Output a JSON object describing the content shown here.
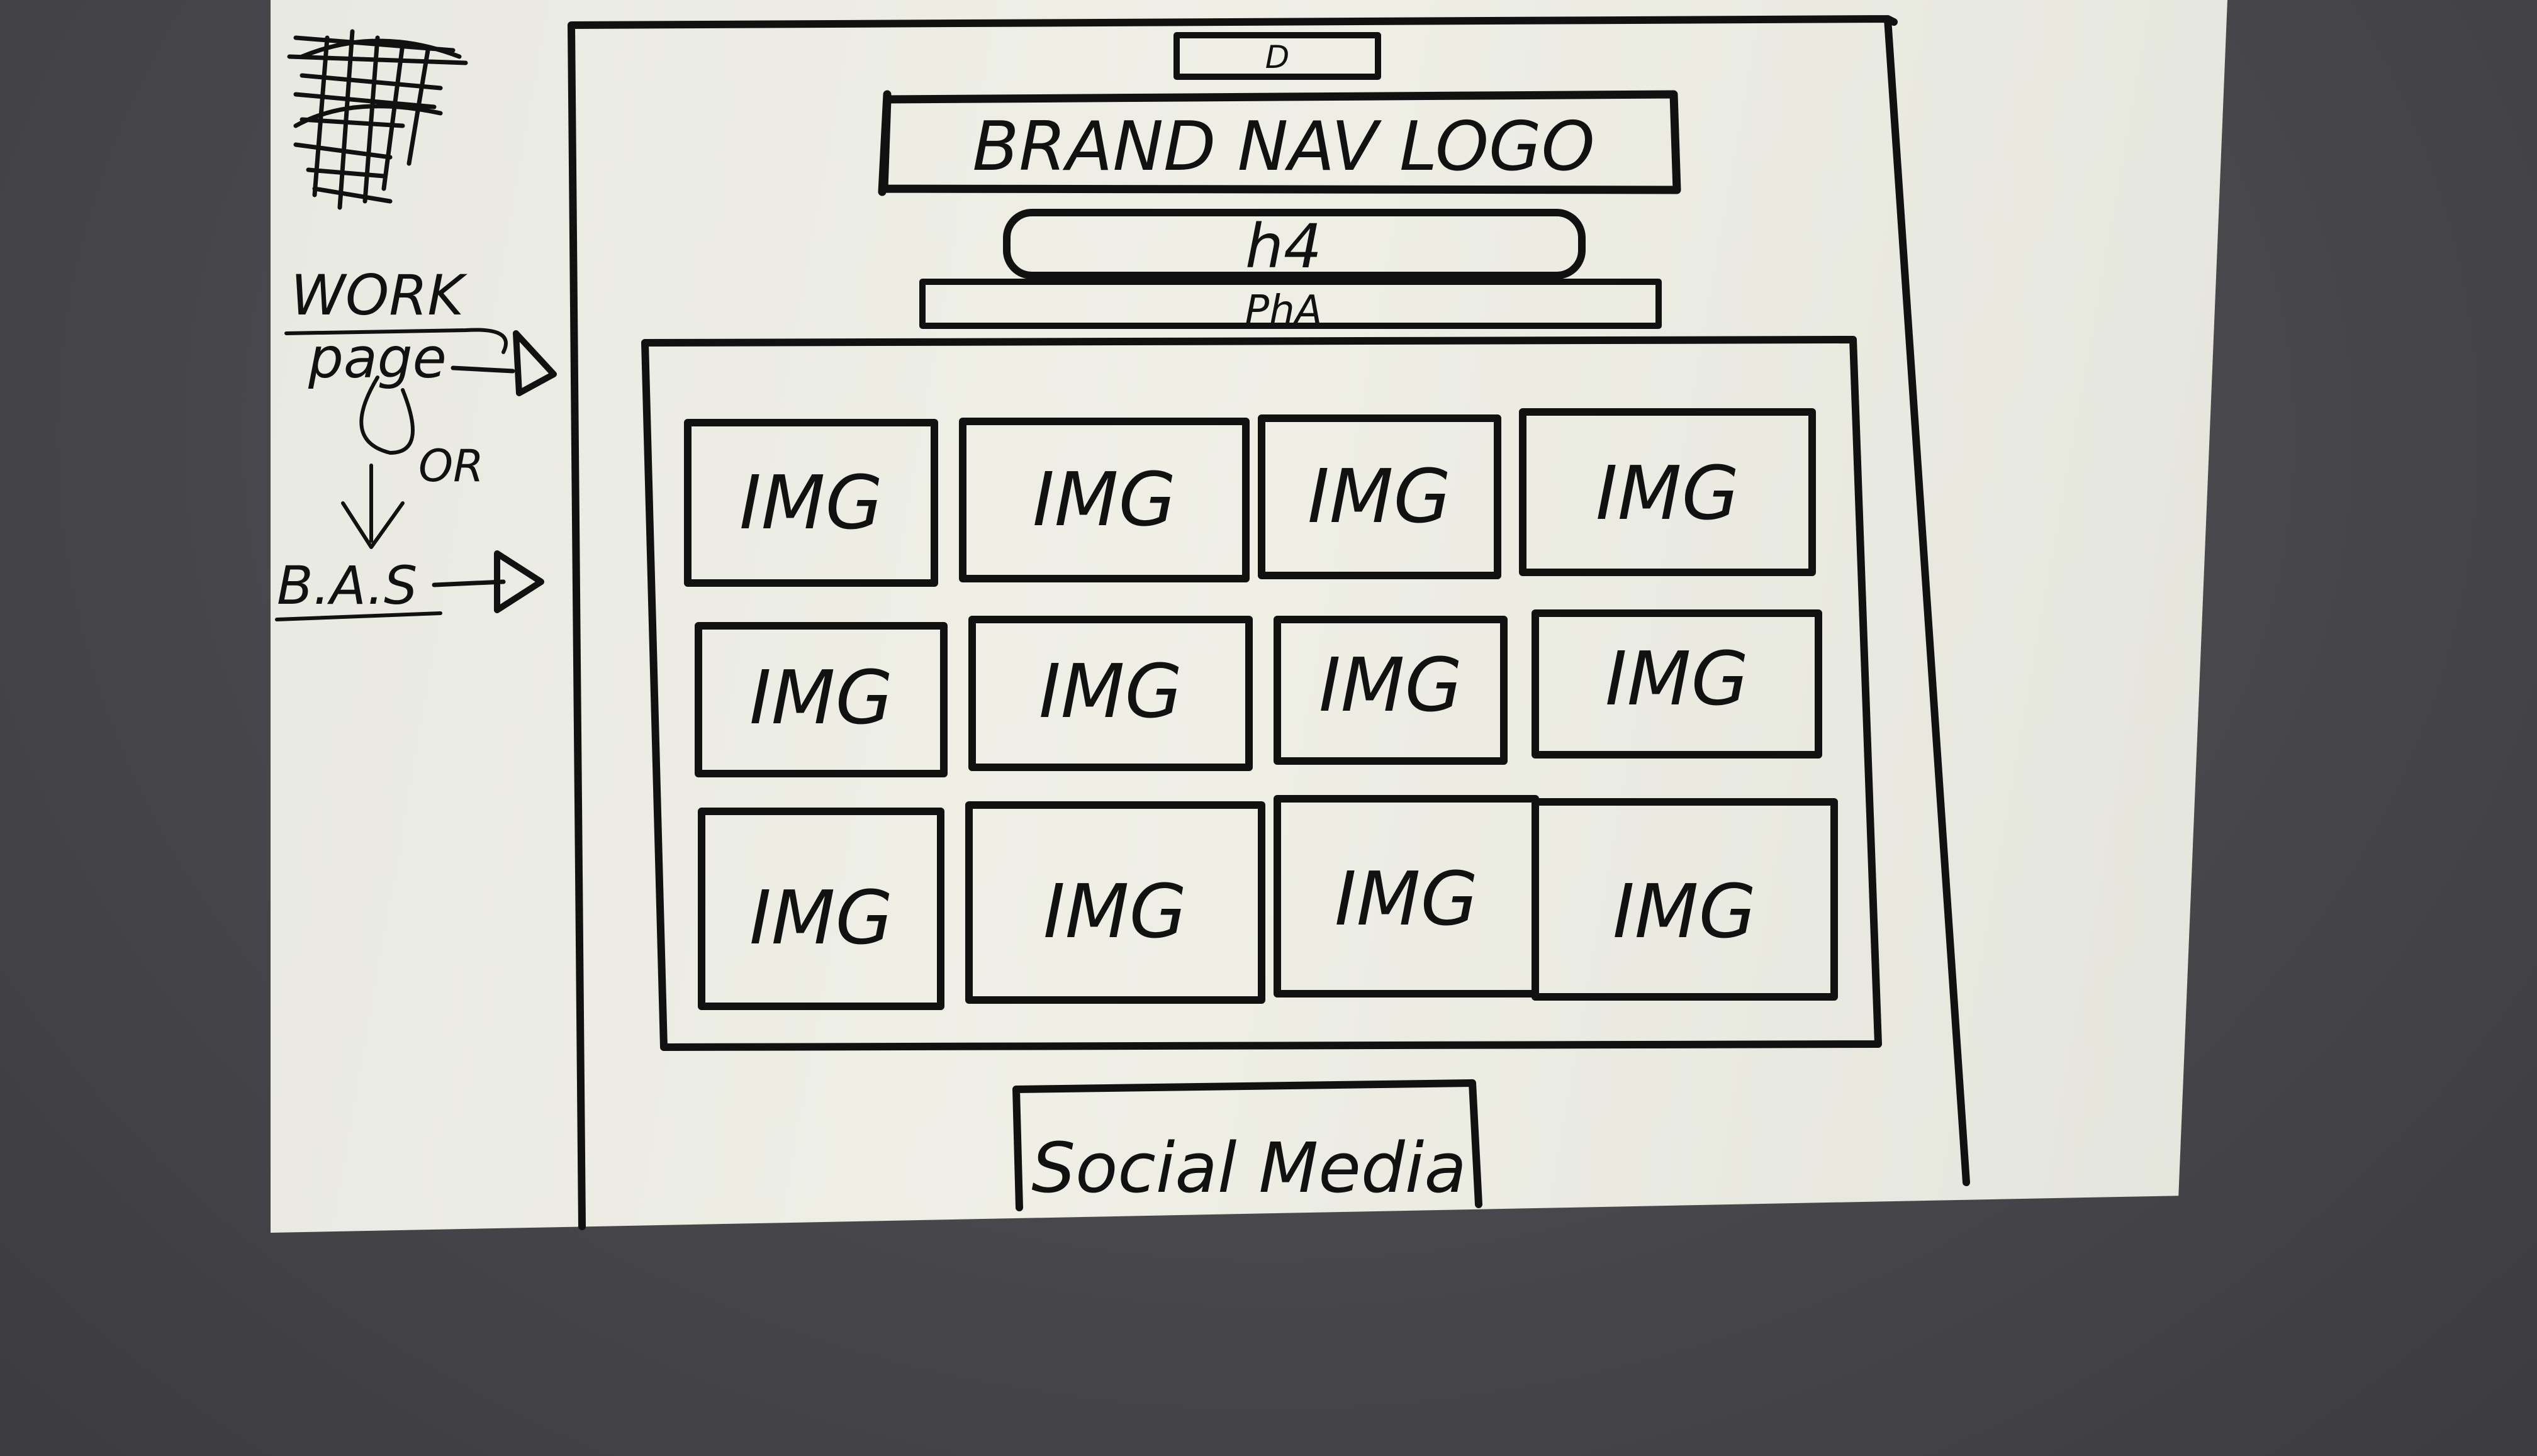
{
  "top_small_box": {
    "label": "D"
  },
  "nav": {
    "label": "BRAND NAV LOGO"
  },
  "heading": {
    "label": "h4"
  },
  "paragraph": {
    "label": "PhA"
  },
  "gallery": {
    "tiles": [
      "IMG",
      "IMG",
      "IMG",
      "IMG",
      "IMG",
      "IMG",
      "IMG",
      "IMG",
      "IMG",
      "IMG",
      "IMG",
      "IMG"
    ]
  },
  "footer": {
    "label": "Social Media"
  },
  "side_notes": {
    "work": "WORK",
    "page": "page",
    "or": "OR",
    "bas": "B.A.S"
  },
  "colors": {
    "ink": "#111111",
    "paper": "#ecece3",
    "background": "#4a4a4e"
  }
}
